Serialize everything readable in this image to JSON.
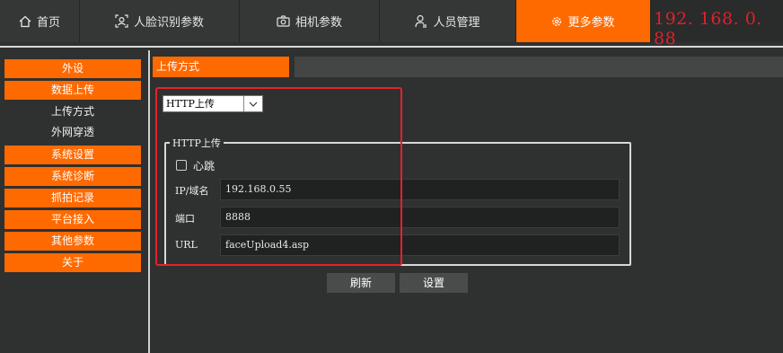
{
  "nav": {
    "tabs": [
      {
        "label": "首页",
        "icon": "home-icon"
      },
      {
        "label": "人脸识别参数",
        "icon": "face-scan-icon"
      },
      {
        "label": "相机参数",
        "icon": "camera-icon"
      },
      {
        "label": "人员管理",
        "icon": "person-icon"
      },
      {
        "label": "更多参数",
        "icon": "gear-icon",
        "active": true
      }
    ],
    "ip": "192. 168. 0. 88"
  },
  "sidebar": {
    "items": [
      {
        "label": "外设",
        "style": "orange"
      },
      {
        "label": "数据上传",
        "style": "orange"
      },
      {
        "label": "上传方式",
        "style": "plain"
      },
      {
        "label": "外网穿透",
        "style": "plain"
      },
      {
        "label": "系统设置",
        "style": "orange"
      },
      {
        "label": "系统诊断",
        "style": "orange"
      },
      {
        "label": "抓拍记录",
        "style": "orange"
      },
      {
        "label": "平台接入",
        "style": "orange"
      },
      {
        "label": "其他参数",
        "style": "orange"
      },
      {
        "label": "关于",
        "style": "orange"
      }
    ]
  },
  "main": {
    "section_title": "上传方式",
    "upload_mode": {
      "selected": "HTTP上传"
    },
    "http": {
      "legend": "HTTP上传",
      "heartbeat_label": "心跳",
      "heartbeat_checked": false,
      "ip_label": "IP/域名",
      "ip_value": "192.168.0.55",
      "port_label": "端口",
      "port_value": "8888",
      "url_label": "URL",
      "url_value": "faceUpload4.asp"
    },
    "refresh_label": "刷新",
    "set_label": "设置"
  },
  "colors": {
    "accent": "#ff6a00",
    "ip_text": "#e0202a",
    "highlight_box": "#e8202a"
  }
}
